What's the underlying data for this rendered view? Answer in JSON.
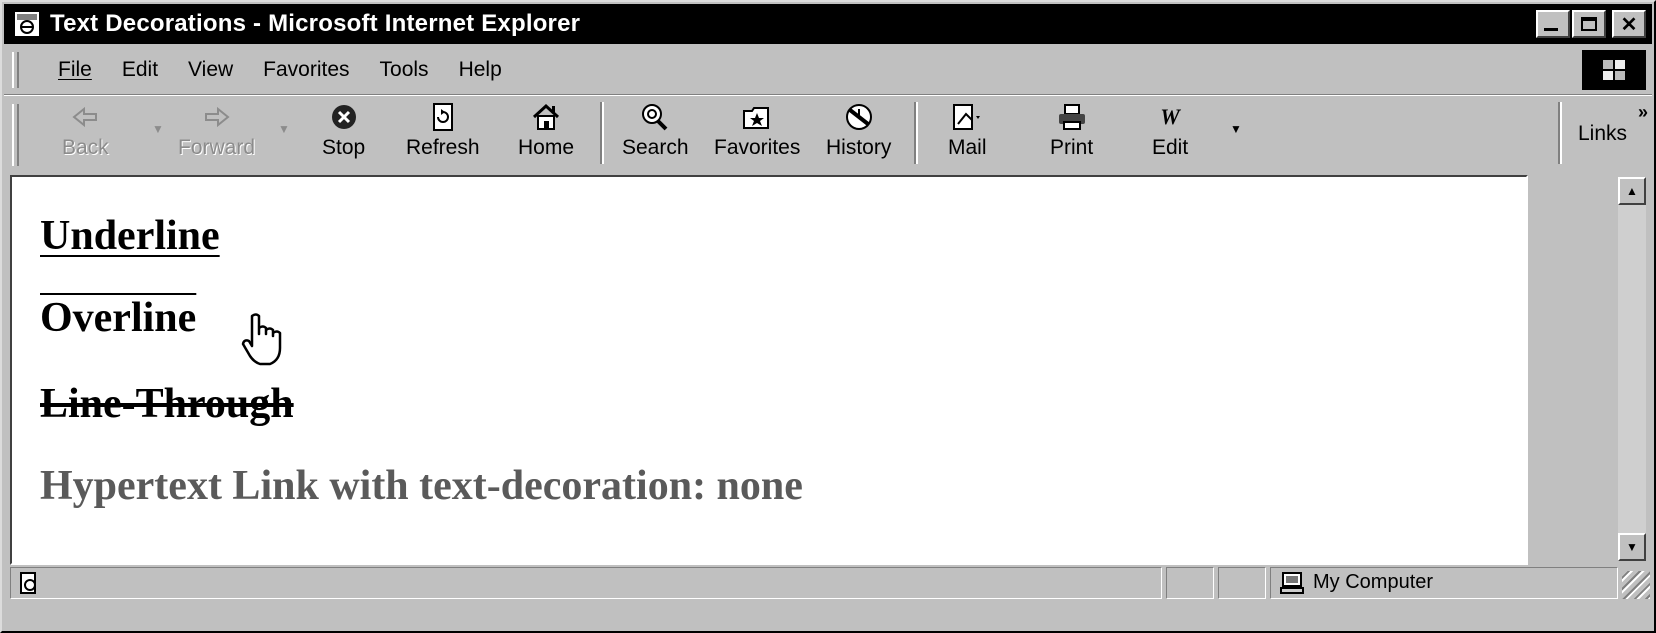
{
  "window": {
    "title": "Text Decorations - Microsoft Internet Explorer",
    "controls": [
      "minimize-icon",
      "maximize-icon",
      "close-icon"
    ]
  },
  "menubar": {
    "items": [
      "File",
      "Edit",
      "View",
      "Favorites",
      "Tools",
      "Help"
    ]
  },
  "toolbar": {
    "buttons": [
      {
        "label": "Back",
        "icon": "back-arrow-icon",
        "enabled": false
      },
      {
        "label": "Forward",
        "icon": "forward-arrow-icon",
        "enabled": false
      },
      {
        "label": "Stop",
        "icon": "stop-icon",
        "enabled": true
      },
      {
        "label": "Refresh",
        "icon": "refresh-icon",
        "enabled": true
      },
      {
        "label": "Home",
        "icon": "home-icon",
        "enabled": true
      },
      {
        "label": "Search",
        "icon": "search-icon",
        "enabled": true
      },
      {
        "label": "Favorites",
        "icon": "favorites-icon",
        "enabled": true
      },
      {
        "label": "History",
        "icon": "history-icon",
        "enabled": true
      },
      {
        "label": "Mail",
        "icon": "mail-icon",
        "enabled": true
      },
      {
        "label": "Print",
        "icon": "printer-icon",
        "enabled": true
      },
      {
        "label": "Edit",
        "icon": "edit-icon",
        "enabled": true
      }
    ],
    "links_label": "Links"
  },
  "content": {
    "underline": "Underline",
    "overline": "Overline",
    "linethrough": "Line-Through",
    "link": "Hypertext Link with text-decoration: none"
  },
  "statusbar": {
    "status_text": "",
    "zone": "My Computer"
  },
  "colors": {
    "chrome": "#c0c0c0",
    "titlebar": "#000000",
    "page_bg": "#ffffff",
    "link_text": "#5a5a5a"
  }
}
